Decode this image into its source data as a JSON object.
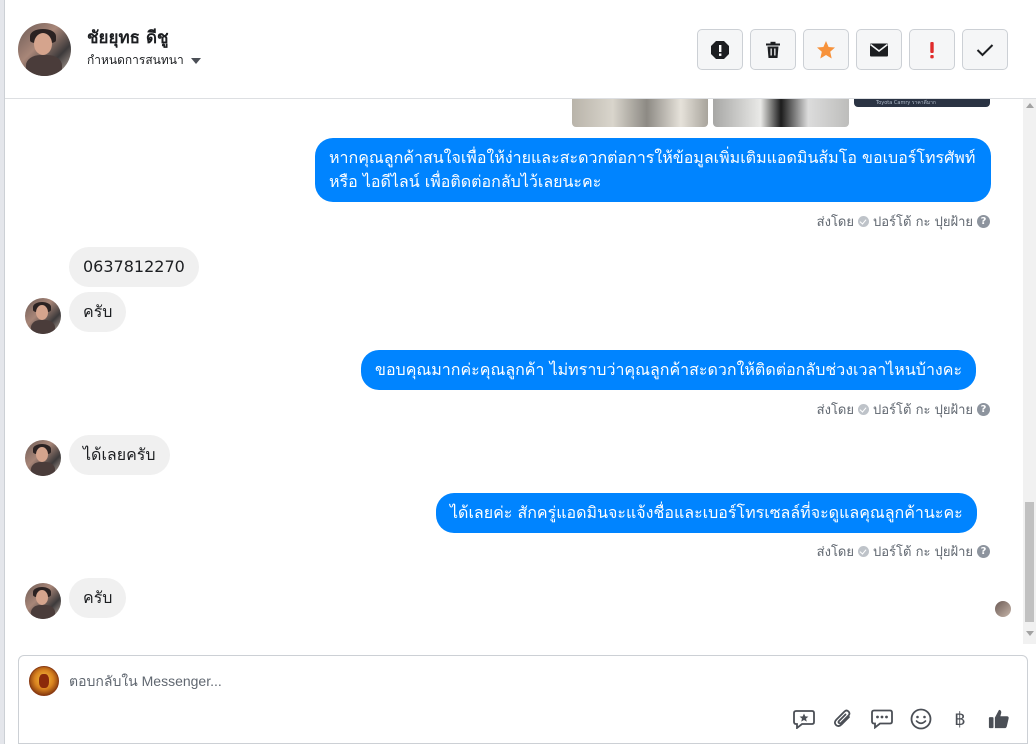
{
  "header": {
    "contact_name": "ชัยยุทธ ดีชู",
    "assign_label": "กำหนดการสนทนา",
    "actions": [
      {
        "name": "report-icon",
        "label": "Report"
      },
      {
        "name": "trash-icon",
        "label": "Delete"
      },
      {
        "name": "star-icon",
        "label": "Star"
      },
      {
        "name": "envelope-icon",
        "label": "Mark unread"
      },
      {
        "name": "exclamation-icon",
        "label": "Important"
      },
      {
        "name": "check-icon",
        "label": "Done"
      }
    ],
    "colors": {
      "star": "#f7923b",
      "important": "#e02b2b"
    }
  },
  "messages": {
    "image_caption": "Toyota Camry ราคาดีมาก",
    "m1": {
      "text": "หากคุณลูกค้าสนใจเพื่อให้ง่ายและสะดวกต่อการให้ข้อมูลเพิ่มเติมแอดมินส้มโอ ขอเบอร์โทรศัพท์ หรือ ไอดีไลน์ เพื่อติดต่อกลับไว้เลยนะคะ"
    },
    "sent_prefix": "ส่งโดย",
    "sender": "ปอร์โต้ กะ ปุยฝ้าย",
    "m2": {
      "text": "0637812270"
    },
    "m3": {
      "text": "ครับ"
    },
    "m4": {
      "text": "ขอบคุณมากค่ะคุณลูกค้า ไม่ทราบว่าคุณลูกค้าสะดวกให้ติดต่อกลับช่วงเวลาไหนบ้างคะ"
    },
    "m5": {
      "text": "ได้เลยครับ"
    },
    "m6": {
      "text": "ได้เลยค่ะ สักครู่แอดมินจะแจ้งชื่อและเบอร์โทรเซลล์ที่จะดูแลคุณลูกค้านะคะ"
    },
    "m7": {
      "text": "ครับ"
    },
    "outgoing_color": "#0084ff"
  },
  "composer": {
    "placeholder": "ตอบกลับใน Messenger...",
    "currency_symbol": "฿",
    "tools": [
      "saved-reply-icon",
      "attachment-icon",
      "chat-bubble-icon",
      "emoji-icon",
      "currency-icon",
      "like-icon"
    ]
  }
}
